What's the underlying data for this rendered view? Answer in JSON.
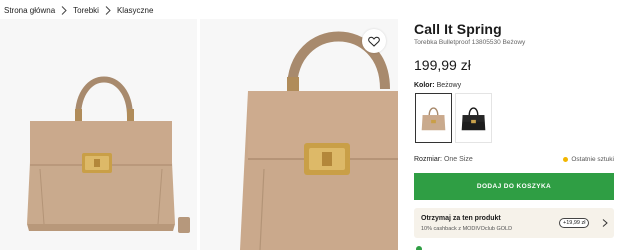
{
  "breadcrumb": {
    "items": [
      "Strona główna",
      "Torebki",
      "Klasyczne"
    ]
  },
  "product": {
    "brand": "Call It Spring",
    "subtitle": "Torebka Bulletproof 13805530 Beżowy",
    "price": "199,99 zł",
    "color_label": "Kolor:",
    "color_value": "Beżowy",
    "size_label": "Rozmiar:",
    "size_value": "One Size",
    "stock_status": "Ostatnie sztuki",
    "add_to_cart": "DODAJ DO KOSZYKA"
  },
  "cashback": {
    "title": "Otrzymaj za ten produkt",
    "subtitle": "10% cashback z MODIVOclub GOLD",
    "badge": "+19,99 zł"
  },
  "colors": {
    "accent_green": "#2f9e44",
    "stock_dot": "#f2b600",
    "bag_beige": "#c9aa8d",
    "cashback_bg": "#f6f2ea"
  },
  "icons": {
    "breadcrumb_separator": "chevron-right-icon",
    "favorite": "heart-icon",
    "cashback_arrow": "chevron-right-icon"
  }
}
